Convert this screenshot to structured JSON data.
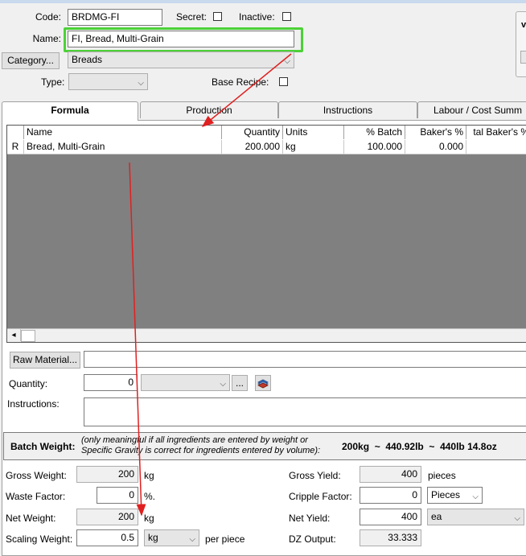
{
  "header": {
    "code_label": "Code:",
    "code_value": "BRDMG-FI",
    "secret_label": "Secret:",
    "inactive_label": "Inactive:",
    "name_label": "Name:",
    "name_value": "FI, Bread, Multi-Grain",
    "category_button": "Category...",
    "category_value": "Breads",
    "type_label": "Type:",
    "type_value": "",
    "base_recipe_label": "Base Recipe:",
    "highlight_color": "#4cd137",
    "annotation_arrow_color": "#e02020"
  },
  "tabs": [
    {
      "label": "Formula",
      "active": true
    },
    {
      "label": "Production",
      "active": false
    },
    {
      "label": "Instructions",
      "active": false
    },
    {
      "label": "Labour / Cost Summ",
      "active": false
    }
  ],
  "grid": {
    "columns": [
      "Name",
      "Quantity",
      "Units",
      "% Batch",
      "Baker's %",
      "tal Baker's %"
    ],
    "rows": [
      {
        "marker": "R",
        "name": "Bread, Multi-Grain",
        "quantity": "200.000",
        "units": "kg",
        "batch": "100.000",
        "bakers": "0.000",
        "total_bakers": ""
      }
    ],
    "scroll_left_icon": "◂"
  },
  "editor": {
    "raw_material_button": "Raw Material...",
    "raw_material_value": "",
    "quantity_label": "Quantity:",
    "quantity_value": "0",
    "unit_value": "",
    "ellipsis_button": "...",
    "instructions_label": "Instructions:",
    "instructions_value": ""
  },
  "batch": {
    "label": "Batch Weight:",
    "note": "(only meaningful if all ingredients are entered by weight or Specific Gravity is correct for ingredients entered by volume):",
    "value": "200kg  ~  440.92lb  ~  440lb 14.8oz"
  },
  "weights": {
    "gross_weight_label": "Gross Weight:",
    "gross_weight_value": "200",
    "gross_weight_unit": "kg",
    "waste_factor_label": "Waste Factor:",
    "waste_factor_value": "0",
    "waste_factor_unit": "%.",
    "net_weight_label": "Net Weight:",
    "net_weight_value": "200",
    "net_weight_unit": "kg",
    "scaling_weight_label": "Scaling Weight:",
    "scaling_weight_value": "0.5",
    "scaling_unit": "kg",
    "per_piece": "per piece"
  },
  "yields": {
    "gross_yield_label": "Gross Yield:",
    "gross_yield_value": "400",
    "gross_yield_unit": "pieces",
    "cripple_factor_label": "Cripple Factor:",
    "cripple_factor_value": "0",
    "cripple_unit": "Pieces",
    "net_yield_label": "Net Yield:",
    "net_yield_value": "400",
    "net_yield_unit": "ea",
    "dz_output_label": "DZ Output:",
    "dz_output_value": "33.333"
  }
}
